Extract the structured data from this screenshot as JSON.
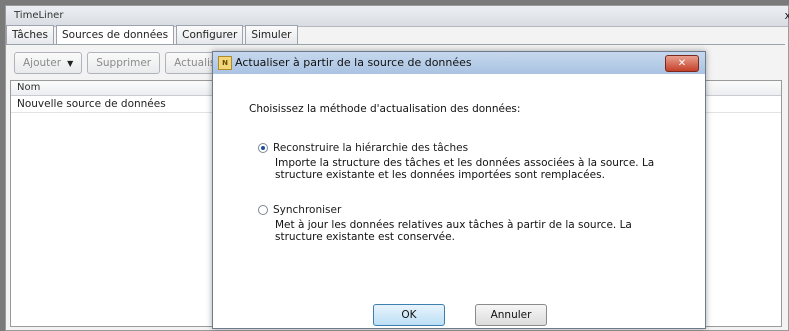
{
  "panel": {
    "title": "TimeLiner",
    "close_glyph": "x"
  },
  "tabs": [
    "Tâches",
    "Sources de données",
    "Configurer",
    "Simuler"
  ],
  "toolbar": {
    "add": "Ajouter",
    "delete": "Supprimer",
    "refresh": "Actualise"
  },
  "list": {
    "header": "Nom",
    "rows": [
      "Nouvelle source de données"
    ]
  },
  "dialog": {
    "title": "Actualiser à partir de la source de données",
    "close_glyph": "✕",
    "prompt": "Choisissez la méthode d'actualisation des données:",
    "options": [
      {
        "label": "Reconstruire la hiérarchie des tâches",
        "checked": true,
        "description": "Importe la structure des tâches et les données associées à la source. La  structure existante et les données importées sont remplacées."
      },
      {
        "label": "Synchroniser",
        "checked": false,
        "description": "Met à jour les données relatives aux tâches à partir de la source. La structure existante est conservée."
      }
    ],
    "ok": "OK",
    "cancel": "Annuler"
  }
}
